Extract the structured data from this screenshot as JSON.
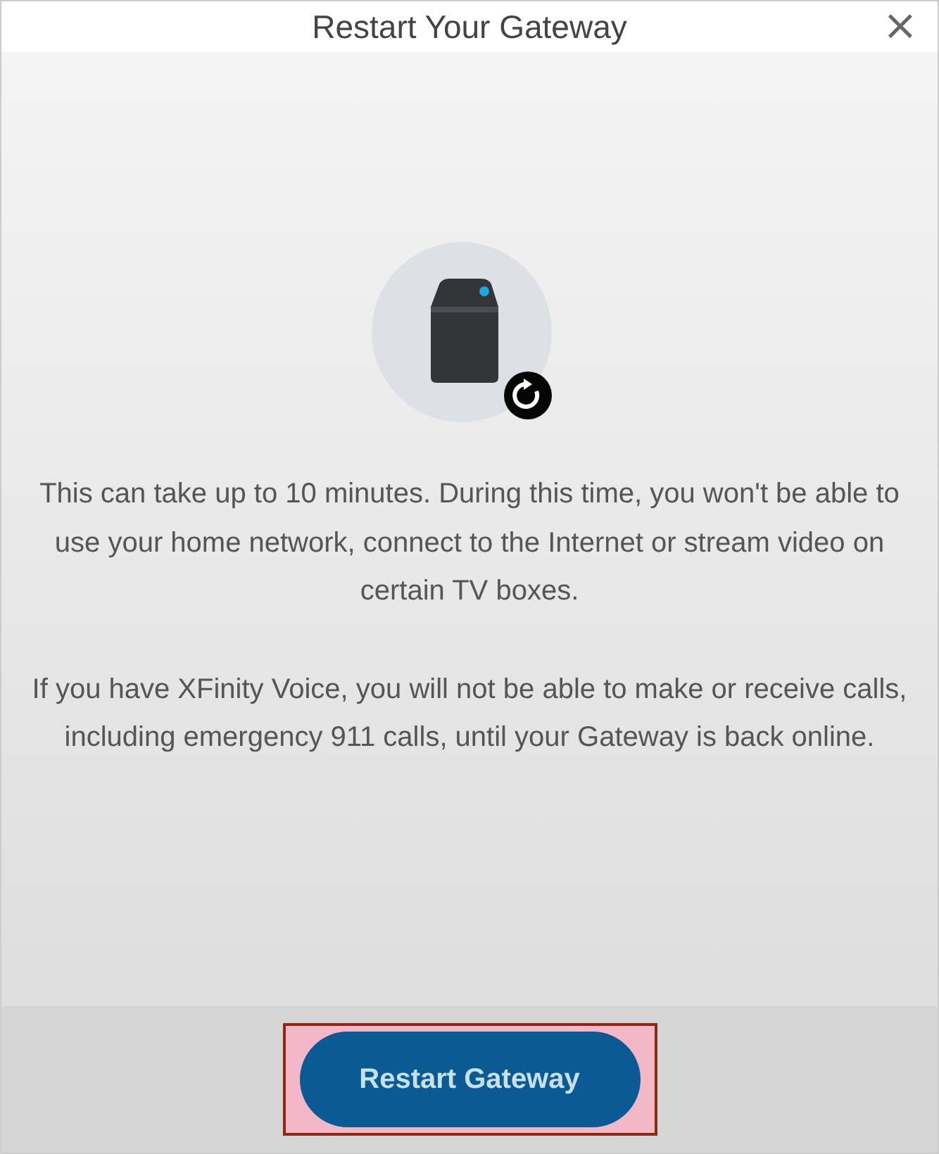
{
  "dialog": {
    "title": "Restart Your Gateway",
    "close": "×"
  },
  "paragraphs": [
    "This can take up to 10 minutes. During this time, you won't be able to use your home network, connect to the Internet or stream video on certain TV boxes.",
    "If you have XFinity Voice, you will not be able to make or receive calls, including emergency 911 calls, until your Gateway is back online."
  ],
  "button": {
    "label": "Restart Gateway"
  }
}
